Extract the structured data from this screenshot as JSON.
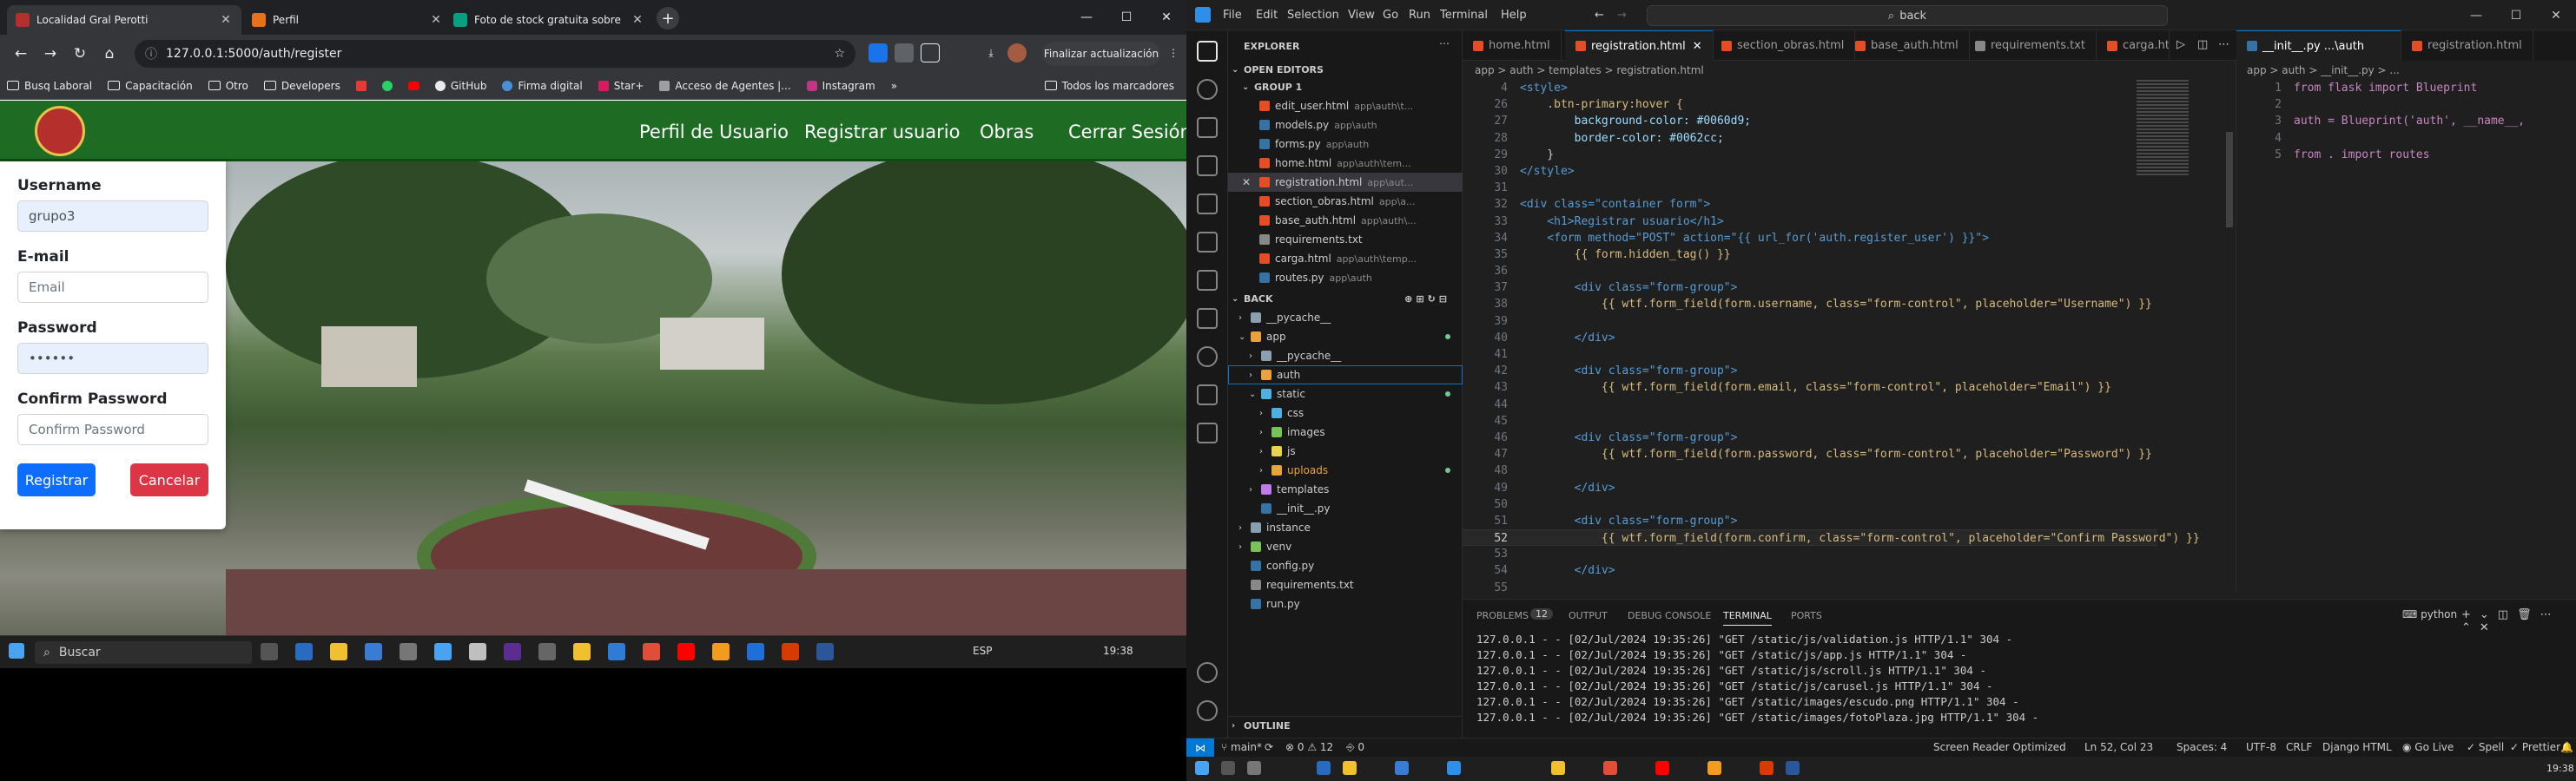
{
  "chrome": {
    "tabs": [
      {
        "title": "Localidad Gral Perotti",
        "active": true
      },
      {
        "title": "Perfil",
        "active": false
      },
      {
        "title": "Foto de stock gratuita sobre cé…",
        "active": false
      }
    ],
    "url": "127.0.0.1:5000/auth/register",
    "update_button": "Finalizar actualización",
    "bookmarks": [
      "Busq Laboral",
      "Capacitación",
      "Otro",
      "Developers",
      "GitHub",
      "Firma digital",
      "Star+",
      "Acceso de Agentes |...",
      "Instagram"
    ],
    "all_bookmarks": "Todos los marcadores",
    "overflow": "»"
  },
  "site": {
    "nav": [
      "Perfil de Usuario",
      "Registrar usuario",
      "Obras",
      "Cerrar Sesión"
    ],
    "form": {
      "username_label": "Username",
      "username_value": "grupo3",
      "email_label": "E-mail",
      "email_placeholder": "Email",
      "password_label": "Password",
      "password_value": "••••••",
      "confirm_label": "Confirm Password",
      "confirm_placeholder": "Confirm Password",
      "submit": "Registrar",
      "cancel": "Cancelar"
    }
  },
  "taskbar_left": {
    "search": "Buscar",
    "lang": "ESP",
    "time": "19:38"
  },
  "vscode": {
    "menu": [
      "File",
      "Edit",
      "Selection",
      "View",
      "Go",
      "Run",
      "Terminal",
      "Help"
    ],
    "command_center": "back",
    "explorer": {
      "title": "EXPLORER",
      "open_editors": "OPEN EDITORS",
      "group": "GROUP 1",
      "open_files": [
        {
          "name": "edit_user.html",
          "desc": "app\\auth\\t..."
        },
        {
          "name": "models.py",
          "desc": "app\\auth"
        },
        {
          "name": "forms.py",
          "desc": "app\\auth"
        },
        {
          "name": "home.html",
          "desc": "app\\auth\\tem..."
        },
        {
          "name": "registration.html",
          "desc": "app\\aut..."
        },
        {
          "name": "section_obras.html",
          "desc": "app\\a..."
        },
        {
          "name": "base_auth.html",
          "desc": "app\\auth\\..."
        },
        {
          "name": "requirements.txt",
          "desc": ""
        },
        {
          "name": "carga.html",
          "desc": "app\\auth\\temp..."
        },
        {
          "name": "routes.py",
          "desc": "app\\auth"
        }
      ],
      "project": "BACK",
      "tree": [
        {
          "name": "__pycache__",
          "depth": 1,
          "type": "folder"
        },
        {
          "name": "app",
          "depth": 1,
          "type": "folder-open"
        },
        {
          "name": "__pycache__",
          "depth": 2,
          "type": "folder"
        },
        {
          "name": "auth",
          "depth": 2,
          "type": "folder"
        },
        {
          "name": "static",
          "depth": 2,
          "type": "folder-open"
        },
        {
          "name": "css",
          "depth": 3,
          "type": "folder"
        },
        {
          "name": "images",
          "depth": 3,
          "type": "folder"
        },
        {
          "name": "js",
          "depth": 3,
          "type": "folder"
        },
        {
          "name": "uploads",
          "depth": 3,
          "type": "folder"
        },
        {
          "name": "templates",
          "depth": 2,
          "type": "folder"
        },
        {
          "name": "__init__.py",
          "depth": 2,
          "type": "file"
        },
        {
          "name": "instance",
          "depth": 1,
          "type": "folder"
        },
        {
          "name": "venv",
          "depth": 1,
          "type": "folder"
        },
        {
          "name": "config.py",
          "depth": 1,
          "type": "file"
        },
        {
          "name": "requirements.txt",
          "depth": 1,
          "type": "file"
        },
        {
          "name": "run.py",
          "depth": 1,
          "type": "file"
        }
      ],
      "outline": "OUTLINE"
    },
    "editor_tabs": [
      "home.html",
      "registration.html",
      "section_obras.html",
      "base_auth.html",
      "requirements.txt",
      "carga.htm"
    ],
    "breadcrumb": "app > auth > templates > registration.html",
    "code_lines": [
      {
        "n": "4",
        "t": "<style>"
      },
      {
        "n": "26",
        "t": "    .btn-primary:hover {"
      },
      {
        "n": "27",
        "t": "        background-color: #0060d9;"
      },
      {
        "n": "28",
        "t": "        border-color: #0062cc;"
      },
      {
        "n": "29",
        "t": "    }"
      },
      {
        "n": "30",
        "t": "</style>"
      },
      {
        "n": "31",
        "t": ""
      },
      {
        "n": "32",
        "t": "<div class=\"container form\">"
      },
      {
        "n": "33",
        "t": "    <h1>Registrar usuario</h1>"
      },
      {
        "n": "34",
        "t": "    <form method=\"POST\" action=\"{{ url_for('auth.register_user') }}\">"
      },
      {
        "n": "35",
        "t": "        {{ form.hidden_tag() }}"
      },
      {
        "n": "36",
        "t": ""
      },
      {
        "n": "37",
        "t": "        <div class=\"form-group\">"
      },
      {
        "n": "38",
        "t": "            {{ wtf.form_field(form.username, class=\"form-control\", placeholder=\"Username\") }}"
      },
      {
        "n": "39",
        "t": ""
      },
      {
        "n": "40",
        "t": "        </div>"
      },
      {
        "n": "41",
        "t": ""
      },
      {
        "n": "42",
        "t": "        <div class=\"form-group\">"
      },
      {
        "n": "43",
        "t": "            {{ wtf.form_field(form.email, class=\"form-control\", placeholder=\"Email\") }}"
      },
      {
        "n": "44",
        "t": ""
      },
      {
        "n": "45",
        "t": ""
      },
      {
        "n": "46",
        "t": "        <div class=\"form-group\">"
      },
      {
        "n": "47",
        "t": "            {{ wtf.form_field(form.password, class=\"form-control\", placeholder=\"Password\") }}"
      },
      {
        "n": "48",
        "t": ""
      },
      {
        "n": "49",
        "t": "        </div>"
      },
      {
        "n": "50",
        "t": ""
      },
      {
        "n": "51",
        "t": "        <div class=\"form-group\">"
      },
      {
        "n": "52",
        "t": "            {{ wtf.form_field(form.confirm, class=\"form-control\", placeholder=\"Confirm Password\") }}"
      },
      {
        "n": "53",
        "t": ""
      },
      {
        "n": "54",
        "t": "        </div>"
      },
      {
        "n": "55",
        "t": ""
      }
    ],
    "split": {
      "tabs": [
        "__init__.py ...\\auth",
        "registration.html"
      ],
      "breadcrumb": "app > auth > __init__.py > ...",
      "lines": [
        {
          "n": "1",
          "t": "from flask import Blueprint"
        },
        {
          "n": "2",
          "t": ""
        },
        {
          "n": "3",
          "t": "auth = Blueprint('auth', __name__,"
        },
        {
          "n": "4",
          "t": ""
        },
        {
          "n": "5",
          "t": "from . import routes"
        }
      ]
    },
    "panel": {
      "tabs": [
        "PROBLEMS",
        "OUTPUT",
        "DEBUG CONSOLE",
        "TERMINAL",
        "PORTS"
      ],
      "problems_count": "12",
      "terminal_name": "python",
      "lines": [
        "127.0.0.1 - - [02/Jul/2024 19:35:26] \"GET /static/js/validation.js HTTP/1.1\" 304 -",
        "127.0.0.1 - - [02/Jul/2024 19:35:26] \"GET /static/js/app.js HTTP/1.1\" 304 -",
        "127.0.0.1 - - [02/Jul/2024 19:35:26] \"GET /static/js/scroll.js HTTP/1.1\" 304 -",
        "127.0.0.1 - - [02/Jul/2024 19:35:26] \"GET /static/js/carusel.js HTTP/1.1\" 304 -",
        "127.0.0.1 - - [02/Jul/2024 19:35:26] \"GET /static/images/escudo.png HTTP/1.1\" 304 -",
        "127.0.0.1 - - [02/Jul/2024 19:35:26] \"GET /static/images/fotoPlaza.jpg HTTP/1.1\" 304 -"
      ]
    },
    "status": {
      "branch": "main*",
      "errors": "0",
      "warnings": "12",
      "ports": "0",
      "reader": "Screen Reader Optimized",
      "pos": "Ln 52, Col 23",
      "spaces": "Spaces: 4",
      "enc": "UTF-8",
      "eol": "CRLF",
      "lang": "Django HTML",
      "golive": "Go Live",
      "spell": "Spell",
      "prettier": "Prettier"
    },
    "taskbar_time": "19:38"
  }
}
